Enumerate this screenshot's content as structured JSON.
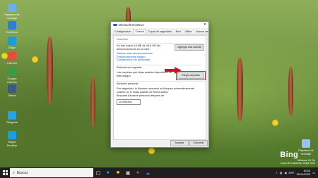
{
  "desktop": {
    "icons": [
      {
        "label": "Papelera de reciclaje",
        "color": "#6bb0e8"
      },
      {
        "label": "OneDrive",
        "color": "#2f7fd1"
      },
      {
        "label": "Edge",
        "color": "#1c9bd8"
      },
      {
        "label": "Chrome",
        "color": "#e44f3b"
      },
      {
        "label": "Google Chrome",
        "color": "#3c9b46"
      },
      {
        "label": "Steam",
        "color": "#3c5a88"
      },
      {
        "label": "Telegram",
        "color": "#2aa3e0"
      },
      {
        "label": "Skype Desktop",
        "color": "#18a0e7"
      }
    ],
    "recycle_bin_label": "Papelera de reciclaje"
  },
  "window": {
    "title": "Microsoft OneDrive",
    "close": "✕",
    "tabs": [
      {
        "label": "Configuración"
      },
      {
        "label": "Cuenta"
      },
      {
        "label": "Copia de seguridad"
      },
      {
        "label": "Red"
      },
      {
        "label": "Office"
      },
      {
        "label": "Acerca de"
      }
    ],
    "account_name": "OneDrive",
    "storage_text": "Se han usado 18 MB de 46,6 GB del almacenamiento en la nube",
    "get_more_link": "Obtener más almacenamiento",
    "privacy_link": "Configuración de privacidad",
    "add_account": "Agregar una cuenta",
    "unlink_link": "Desvincular este equipo",
    "folders_section": "Seleccionar carpetas",
    "folders_text": "Las carpetas que elijas estarán disponibles en este equipo.",
    "choose_folders": "Elegir carpetas",
    "vault_section": "Almacén personal",
    "vault_text": "Por seguridad, tu Almacén personal se bloquea automáticamente cuando no lo estás usando de forma activa.",
    "lock_after_label": "Bloquear Almacén personal después de:",
    "lock_after_value": "20 minutos",
    "ok": "Aceptar",
    "cancel": "Cancelar"
  },
  "watermark": {
    "brand": "Bing",
    "line1": "Windows 10 Pro",
    "line2": "Copia de evaluación. Build 20H2"
  },
  "taskbar": {
    "search_placeholder": "Buscar",
    "time": "18:02",
    "date": "26/11/2020",
    "lang": "ESP"
  },
  "colors": {
    "accent": "#0078d7",
    "highlight": "#d7263d",
    "taskbar": "#1f1f1f"
  }
}
